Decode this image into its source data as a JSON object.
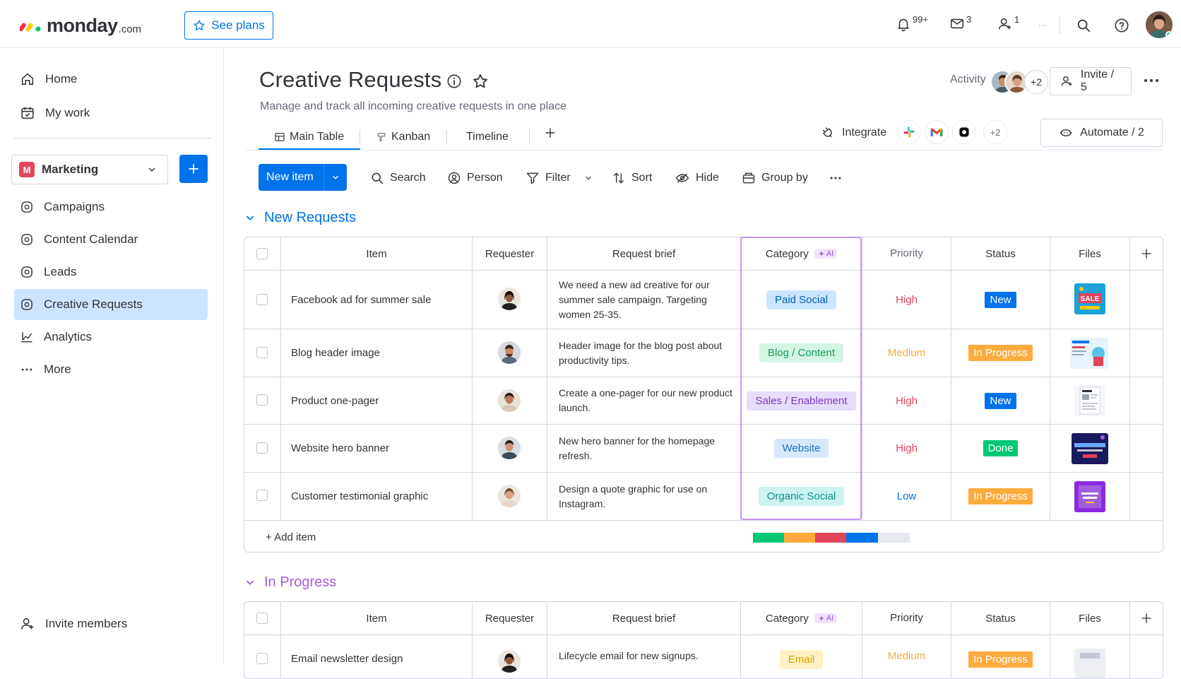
{
  "topbar": {
    "logo_word": "monday",
    "logo_suffix": ".com",
    "see_plans": "See plans",
    "notifications_count": "99+",
    "inbox_count": "3",
    "invite_count": "1"
  },
  "sidebar": {
    "home": "Home",
    "my_work": "My work",
    "workspace_badge": "M",
    "workspace": "Marketing",
    "items": [
      {
        "label": "Campaigns"
      },
      {
        "label": "Content Calendar"
      },
      {
        "label": "Leads"
      },
      {
        "label": "Creative Requests"
      },
      {
        "label": "Analytics"
      },
      {
        "label": "More"
      }
    ],
    "invite_members": "Invite members"
  },
  "board": {
    "title": "Creative Requests",
    "description": "Manage and track all incoming creative requests in one place",
    "activity_label": "Activity",
    "activity_more": "+2",
    "invite": "Invite / 5",
    "tabs": [
      {
        "label": "Main Table"
      },
      {
        "label": "Kanban"
      },
      {
        "label": "Timeline"
      }
    ],
    "integrate": "Integrate",
    "integrations_more": "+2",
    "automate": "Automate / 2"
  },
  "toolbar": {
    "new_item": "New item",
    "search": "Search",
    "person": "Person",
    "filter": "Filter",
    "sort": "Sort",
    "hide": "Hide",
    "group_by": "Group by"
  },
  "columns": {
    "item": "Item",
    "requester": "Requester",
    "brief": "Request brief",
    "category": "Category",
    "ai": "AI",
    "priority": "Priority",
    "status": "Status",
    "files": "Files"
  },
  "groups": [
    {
      "title": "New Requests",
      "color": "#0073ea",
      "rows": [
        {
          "item": "Facebook ad for summer sale",
          "brief": "We need a new ad creative for our summer sale campaign. Targeting women 25-35.",
          "category": "Paid Social",
          "priority": "High",
          "status": "New"
        },
        {
          "item": "Blog header image",
          "brief": "Header image for the blog post about productivity tips.",
          "category": "Blog / Content",
          "priority": "Medium",
          "status": "In Progress"
        },
        {
          "item": "Product one-pager",
          "brief": "Create a one-pager for our new product launch.",
          "category": "Sales / Enablement",
          "priority": "High",
          "status": "New"
        },
        {
          "item": "Website hero banner",
          "brief": "New hero banner for the homepage refresh.",
          "category": "Website",
          "priority": "High",
          "status": "Done"
        },
        {
          "item": "Customer testimonial graphic",
          "brief": "Design a quote graphic for use on Instagram.",
          "category": "Organic Social",
          "priority": "Low",
          "status": "In Progress"
        }
      ],
      "add_item": "+ Add item",
      "status_summary": [
        0.2,
        0.2,
        0.2,
        0.2,
        0.2
      ]
    },
    {
      "title": "In Progress",
      "color": "#a25ddc",
      "rows": [
        {
          "item": "Email newsletter design",
          "brief": "Lifecycle email for new signups.",
          "category": "Email",
          "priority": "Medium",
          "status": "In Progress"
        }
      ]
    }
  ],
  "colors": {
    "primary": "#0073ea",
    "high": "#e2445c",
    "medium": "#fdab3d",
    "low": "#0073ea",
    "status_new": "#0073ea",
    "status_progress": "#fdab3d",
    "status_done": "#00c875"
  }
}
